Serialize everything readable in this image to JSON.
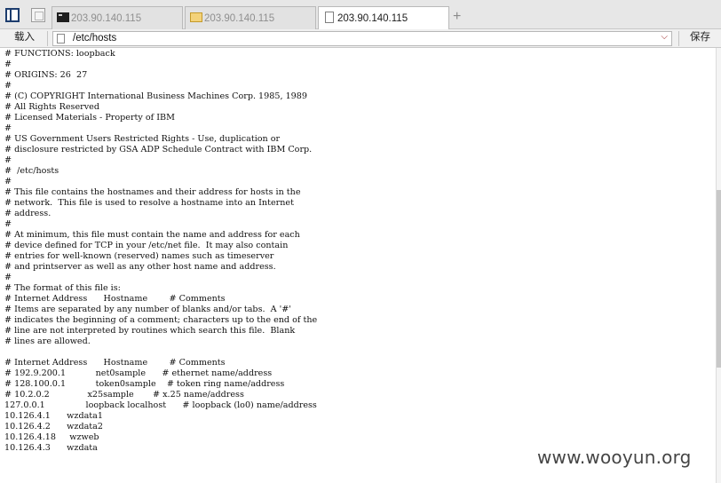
{
  "tabs": [
    {
      "label": "203.90.140.115",
      "icon": "terminal-icon",
      "active": false
    },
    {
      "label": "203.90.140.115",
      "icon": "folder-icon",
      "active": false
    },
    {
      "label": "203.90.140.115",
      "icon": "file-icon",
      "active": true
    }
  ],
  "new_tab_glyph": "+",
  "pathbar": {
    "load_label": "载入",
    "path_value": "/etc/hosts",
    "save_label": "保存"
  },
  "file_lines": [
    "# FUNCTIONS: loopback",
    "#",
    "# ORIGINS: 26  27",
    "#",
    "# (C) COPYRIGHT International Business Machines Corp. 1985, 1989",
    "# All Rights Reserved",
    "# Licensed Materials - Property of IBM",
    "#",
    "# US Government Users Restricted Rights - Use, duplication or",
    "# disclosure restricted by GSA ADP Schedule Contract with IBM Corp.",
    "#",
    "#  /etc/hosts",
    "#",
    "# This file contains the hostnames and their address for hosts in the",
    "# network.  This file is used to resolve a hostname into an Internet",
    "# address.",
    "#",
    "# At minimum, this file must contain the name and address for each",
    "# device defined for TCP in your /etc/net file.  It may also contain",
    "# entries for well-known (reserved) names such as timeserver",
    "# and printserver as well as any other host name and address.",
    "#",
    "# The format of this file is:",
    "# Internet Address      Hostname        # Comments",
    "# Items are separated by any number of blanks and/or tabs.  A '#'",
    "# indicates the beginning of a comment; characters up to the end of the",
    "# line are not interpreted by routines which search this file.  Blank",
    "# lines are allowed.",
    "",
    "# Internet Address      Hostname        # Comments",
    "# 192.9.200.1           net0sample      # ethernet name/address",
    "# 128.100.0.1           token0sample    # token ring name/address",
    "# 10.2.0.2              x25sample       # x.25 name/address",
    "127.0.0.1               loopback localhost      # loopback (lo0) name/address",
    "10.126.4.1      wzdata1",
    "10.126.4.2      wzdata2",
    "10.126.4.18     wzweb",
    "10.126.4.3      wzdata"
  ],
  "watermark": "www.wooyun.org"
}
